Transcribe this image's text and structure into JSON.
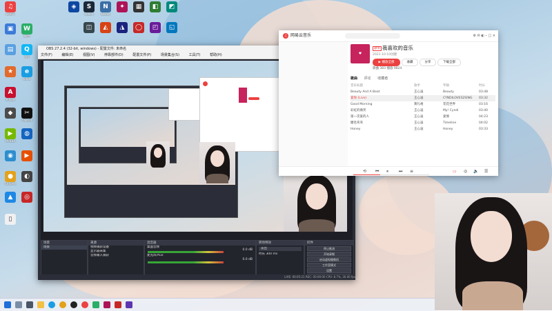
{
  "desktop": {
    "icons": [
      {
        "label": "网易云",
        "icon": "netease-music-icon",
        "color": "#ec4141"
      },
      {
        "label": "Steam",
        "icon": "steam-icon",
        "color": "#1b2838"
      },
      {
        "label": "Nexus",
        "icon": "nexus-icon",
        "color": "#3a6ea5"
      },
      {
        "label": "Adobe",
        "icon": "adobe-icon",
        "color": "#c8102e"
      },
      {
        "label": "CapCut",
        "icon": "capcut-icon",
        "color": "#111111"
      },
      {
        "label": "Edge",
        "icon": "edge-icon",
        "color": "#1b9de2"
      },
      {
        "label": "QQ",
        "icon": "qq-icon",
        "color": "#12b7f5"
      },
      {
        "label": "微信",
        "icon": "wechat-icon",
        "color": "#2aae67"
      },
      {
        "label": "NVIDIA",
        "icon": "nvidia-icon",
        "color": "#76b900"
      },
      {
        "label": "Chrome",
        "icon": "chrome-icon",
        "color": "#e3a21a"
      }
    ]
  },
  "obs": {
    "title": "OBS 27.2.4 (32-bit, windows) - 配置文件: 未命名",
    "menu": [
      "文件(F)",
      "编辑(E)",
      "视图(V)",
      "停靠部件(D)",
      "配置文件(P)",
      "场景集合(S)",
      "工具(T)",
      "帮助(H)"
    ],
    "docks": {
      "scenes": {
        "header": "场景",
        "items": [
          "场景"
        ]
      },
      "sources": {
        "header": "来源",
        "items": [
          "视频捕获设备",
          "显示器采集",
          "音频输入捕获"
        ]
      },
      "mixer": {
        "header": "混音器",
        "tracks": [
          "桌面音频",
          "麦克风/Aux"
        ],
        "db": [
          "0.0 dB",
          "0.0 dB"
        ]
      },
      "transitions": {
        "header": "转场特效",
        "type": "淡出",
        "duration_label": "时长",
        "duration": "300 ms"
      },
      "controls": {
        "header": "控件",
        "buttons": [
          "停止推流",
          "开始录制",
          "启动虚拟摄像机",
          "工作室模式",
          "设置",
          "退出"
        ]
      }
    },
    "status": "LIVE: 00:05:21   REC: 00:00:00   CPU: 8.7%, 30.00 fps"
  },
  "music": {
    "brand": "网易云音乐",
    "playlist_tag": "歌单",
    "playlist_title": "我喜欢的音乐",
    "meta": "2021-10-10创建",
    "play_all": "播放全部",
    "share": "分享",
    "collect": "收藏",
    "download": "下载全部",
    "stats": "歌曲  383    播放  9824",
    "tabs": [
      "歌曲",
      "评论",
      "收藏者"
    ],
    "columns": [
      "音乐标题",
      "歌手",
      "专辑",
      "时长"
    ],
    "songs": [
      {
        "title": "Beauty And A Beat",
        "artist": "王心凌",
        "album": "Beauty",
        "time": "03:48"
      },
      {
        "title": "爱你 (Live)",
        "artist": "王心凌",
        "album": "CYNDILOVES2SING",
        "time": "03:32"
      },
      {
        "title": "Good Morning",
        "artist": "黄礼格",
        "album": "花花世界",
        "time": "03:16"
      },
      {
        "title": "彩虹的微笑",
        "artist": "王心凌",
        "album": "My! Cyndi",
        "time": "03:40"
      },
      {
        "title": "第一次爱的人",
        "artist": "王心凌",
        "album": "爱情",
        "time": "04:23"
      },
      {
        "title": "睫毛弯弯",
        "artist": "王心凌",
        "album": "Timeline",
        "time": "04:02"
      },
      {
        "title": "Honey",
        "artist": "王心凌",
        "album": "Honey",
        "time": "03:33"
      }
    ],
    "progress": 0.35
  },
  "taskbar": {
    "icons": [
      "windows-start-icon",
      "search-icon",
      "task-view-icon",
      "file-explorer-icon",
      "edge-icon",
      "chrome-icon",
      "obs-icon",
      "netease-music-icon"
    ]
  }
}
